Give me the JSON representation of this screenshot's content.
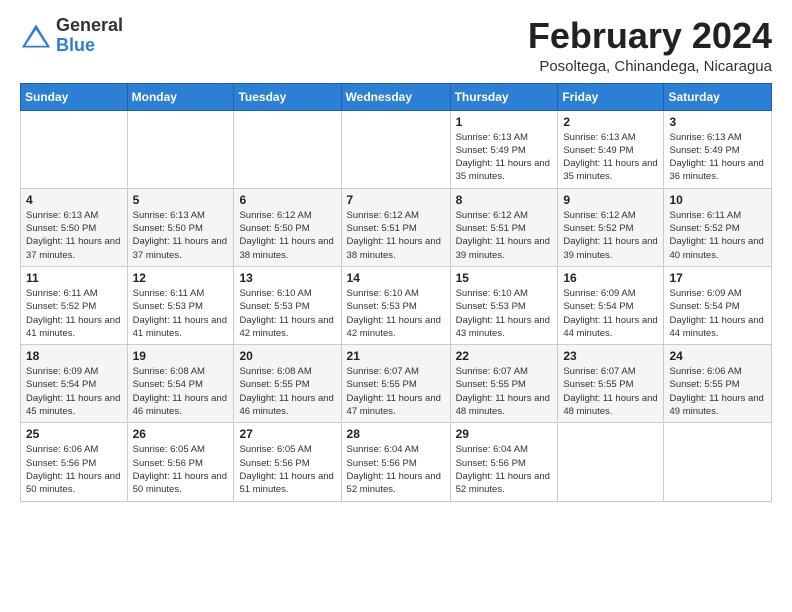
{
  "header": {
    "logo_general": "General",
    "logo_blue": "Blue",
    "month_year": "February 2024",
    "location": "Posoltega, Chinandega, Nicaragua"
  },
  "weekdays": [
    "Sunday",
    "Monday",
    "Tuesday",
    "Wednesday",
    "Thursday",
    "Friday",
    "Saturday"
  ],
  "weeks": [
    [
      {
        "day": "",
        "info": ""
      },
      {
        "day": "",
        "info": ""
      },
      {
        "day": "",
        "info": ""
      },
      {
        "day": "",
        "info": ""
      },
      {
        "day": "1",
        "info": "Sunrise: 6:13 AM\nSunset: 5:49 PM\nDaylight: 11 hours\nand 35 minutes."
      },
      {
        "day": "2",
        "info": "Sunrise: 6:13 AM\nSunset: 5:49 PM\nDaylight: 11 hours\nand 35 minutes."
      },
      {
        "day": "3",
        "info": "Sunrise: 6:13 AM\nSunset: 5:49 PM\nDaylight: 11 hours\nand 36 minutes."
      }
    ],
    [
      {
        "day": "4",
        "info": "Sunrise: 6:13 AM\nSunset: 5:50 PM\nDaylight: 11 hours\nand 37 minutes."
      },
      {
        "day": "5",
        "info": "Sunrise: 6:13 AM\nSunset: 5:50 PM\nDaylight: 11 hours\nand 37 minutes."
      },
      {
        "day": "6",
        "info": "Sunrise: 6:12 AM\nSunset: 5:50 PM\nDaylight: 11 hours\nand 38 minutes."
      },
      {
        "day": "7",
        "info": "Sunrise: 6:12 AM\nSunset: 5:51 PM\nDaylight: 11 hours\nand 38 minutes."
      },
      {
        "day": "8",
        "info": "Sunrise: 6:12 AM\nSunset: 5:51 PM\nDaylight: 11 hours\nand 39 minutes."
      },
      {
        "day": "9",
        "info": "Sunrise: 6:12 AM\nSunset: 5:52 PM\nDaylight: 11 hours\nand 39 minutes."
      },
      {
        "day": "10",
        "info": "Sunrise: 6:11 AM\nSunset: 5:52 PM\nDaylight: 11 hours\nand 40 minutes."
      }
    ],
    [
      {
        "day": "11",
        "info": "Sunrise: 6:11 AM\nSunset: 5:52 PM\nDaylight: 11 hours\nand 41 minutes."
      },
      {
        "day": "12",
        "info": "Sunrise: 6:11 AM\nSunset: 5:53 PM\nDaylight: 11 hours\nand 41 minutes."
      },
      {
        "day": "13",
        "info": "Sunrise: 6:10 AM\nSunset: 5:53 PM\nDaylight: 11 hours\nand 42 minutes."
      },
      {
        "day": "14",
        "info": "Sunrise: 6:10 AM\nSunset: 5:53 PM\nDaylight: 11 hours\nand 42 minutes."
      },
      {
        "day": "15",
        "info": "Sunrise: 6:10 AM\nSunset: 5:53 PM\nDaylight: 11 hours\nand 43 minutes."
      },
      {
        "day": "16",
        "info": "Sunrise: 6:09 AM\nSunset: 5:54 PM\nDaylight: 11 hours\nand 44 minutes."
      },
      {
        "day": "17",
        "info": "Sunrise: 6:09 AM\nSunset: 5:54 PM\nDaylight: 11 hours\nand 44 minutes."
      }
    ],
    [
      {
        "day": "18",
        "info": "Sunrise: 6:09 AM\nSunset: 5:54 PM\nDaylight: 11 hours\nand 45 minutes."
      },
      {
        "day": "19",
        "info": "Sunrise: 6:08 AM\nSunset: 5:54 PM\nDaylight: 11 hours\nand 46 minutes."
      },
      {
        "day": "20",
        "info": "Sunrise: 6:08 AM\nSunset: 5:55 PM\nDaylight: 11 hours\nand 46 minutes."
      },
      {
        "day": "21",
        "info": "Sunrise: 6:07 AM\nSunset: 5:55 PM\nDaylight: 11 hours\nand 47 minutes."
      },
      {
        "day": "22",
        "info": "Sunrise: 6:07 AM\nSunset: 5:55 PM\nDaylight: 11 hours\nand 48 minutes."
      },
      {
        "day": "23",
        "info": "Sunrise: 6:07 AM\nSunset: 5:55 PM\nDaylight: 11 hours\nand 48 minutes."
      },
      {
        "day": "24",
        "info": "Sunrise: 6:06 AM\nSunset: 5:55 PM\nDaylight: 11 hours\nand 49 minutes."
      }
    ],
    [
      {
        "day": "25",
        "info": "Sunrise: 6:06 AM\nSunset: 5:56 PM\nDaylight: 11 hours\nand 50 minutes."
      },
      {
        "day": "26",
        "info": "Sunrise: 6:05 AM\nSunset: 5:56 PM\nDaylight: 11 hours\nand 50 minutes."
      },
      {
        "day": "27",
        "info": "Sunrise: 6:05 AM\nSunset: 5:56 PM\nDaylight: 11 hours\nand 51 minutes."
      },
      {
        "day": "28",
        "info": "Sunrise: 6:04 AM\nSunset: 5:56 PM\nDaylight: 11 hours\nand 52 minutes."
      },
      {
        "day": "29",
        "info": "Sunrise: 6:04 AM\nSunset: 5:56 PM\nDaylight: 11 hours\nand 52 minutes."
      },
      {
        "day": "",
        "info": ""
      },
      {
        "day": "",
        "info": ""
      }
    ]
  ]
}
